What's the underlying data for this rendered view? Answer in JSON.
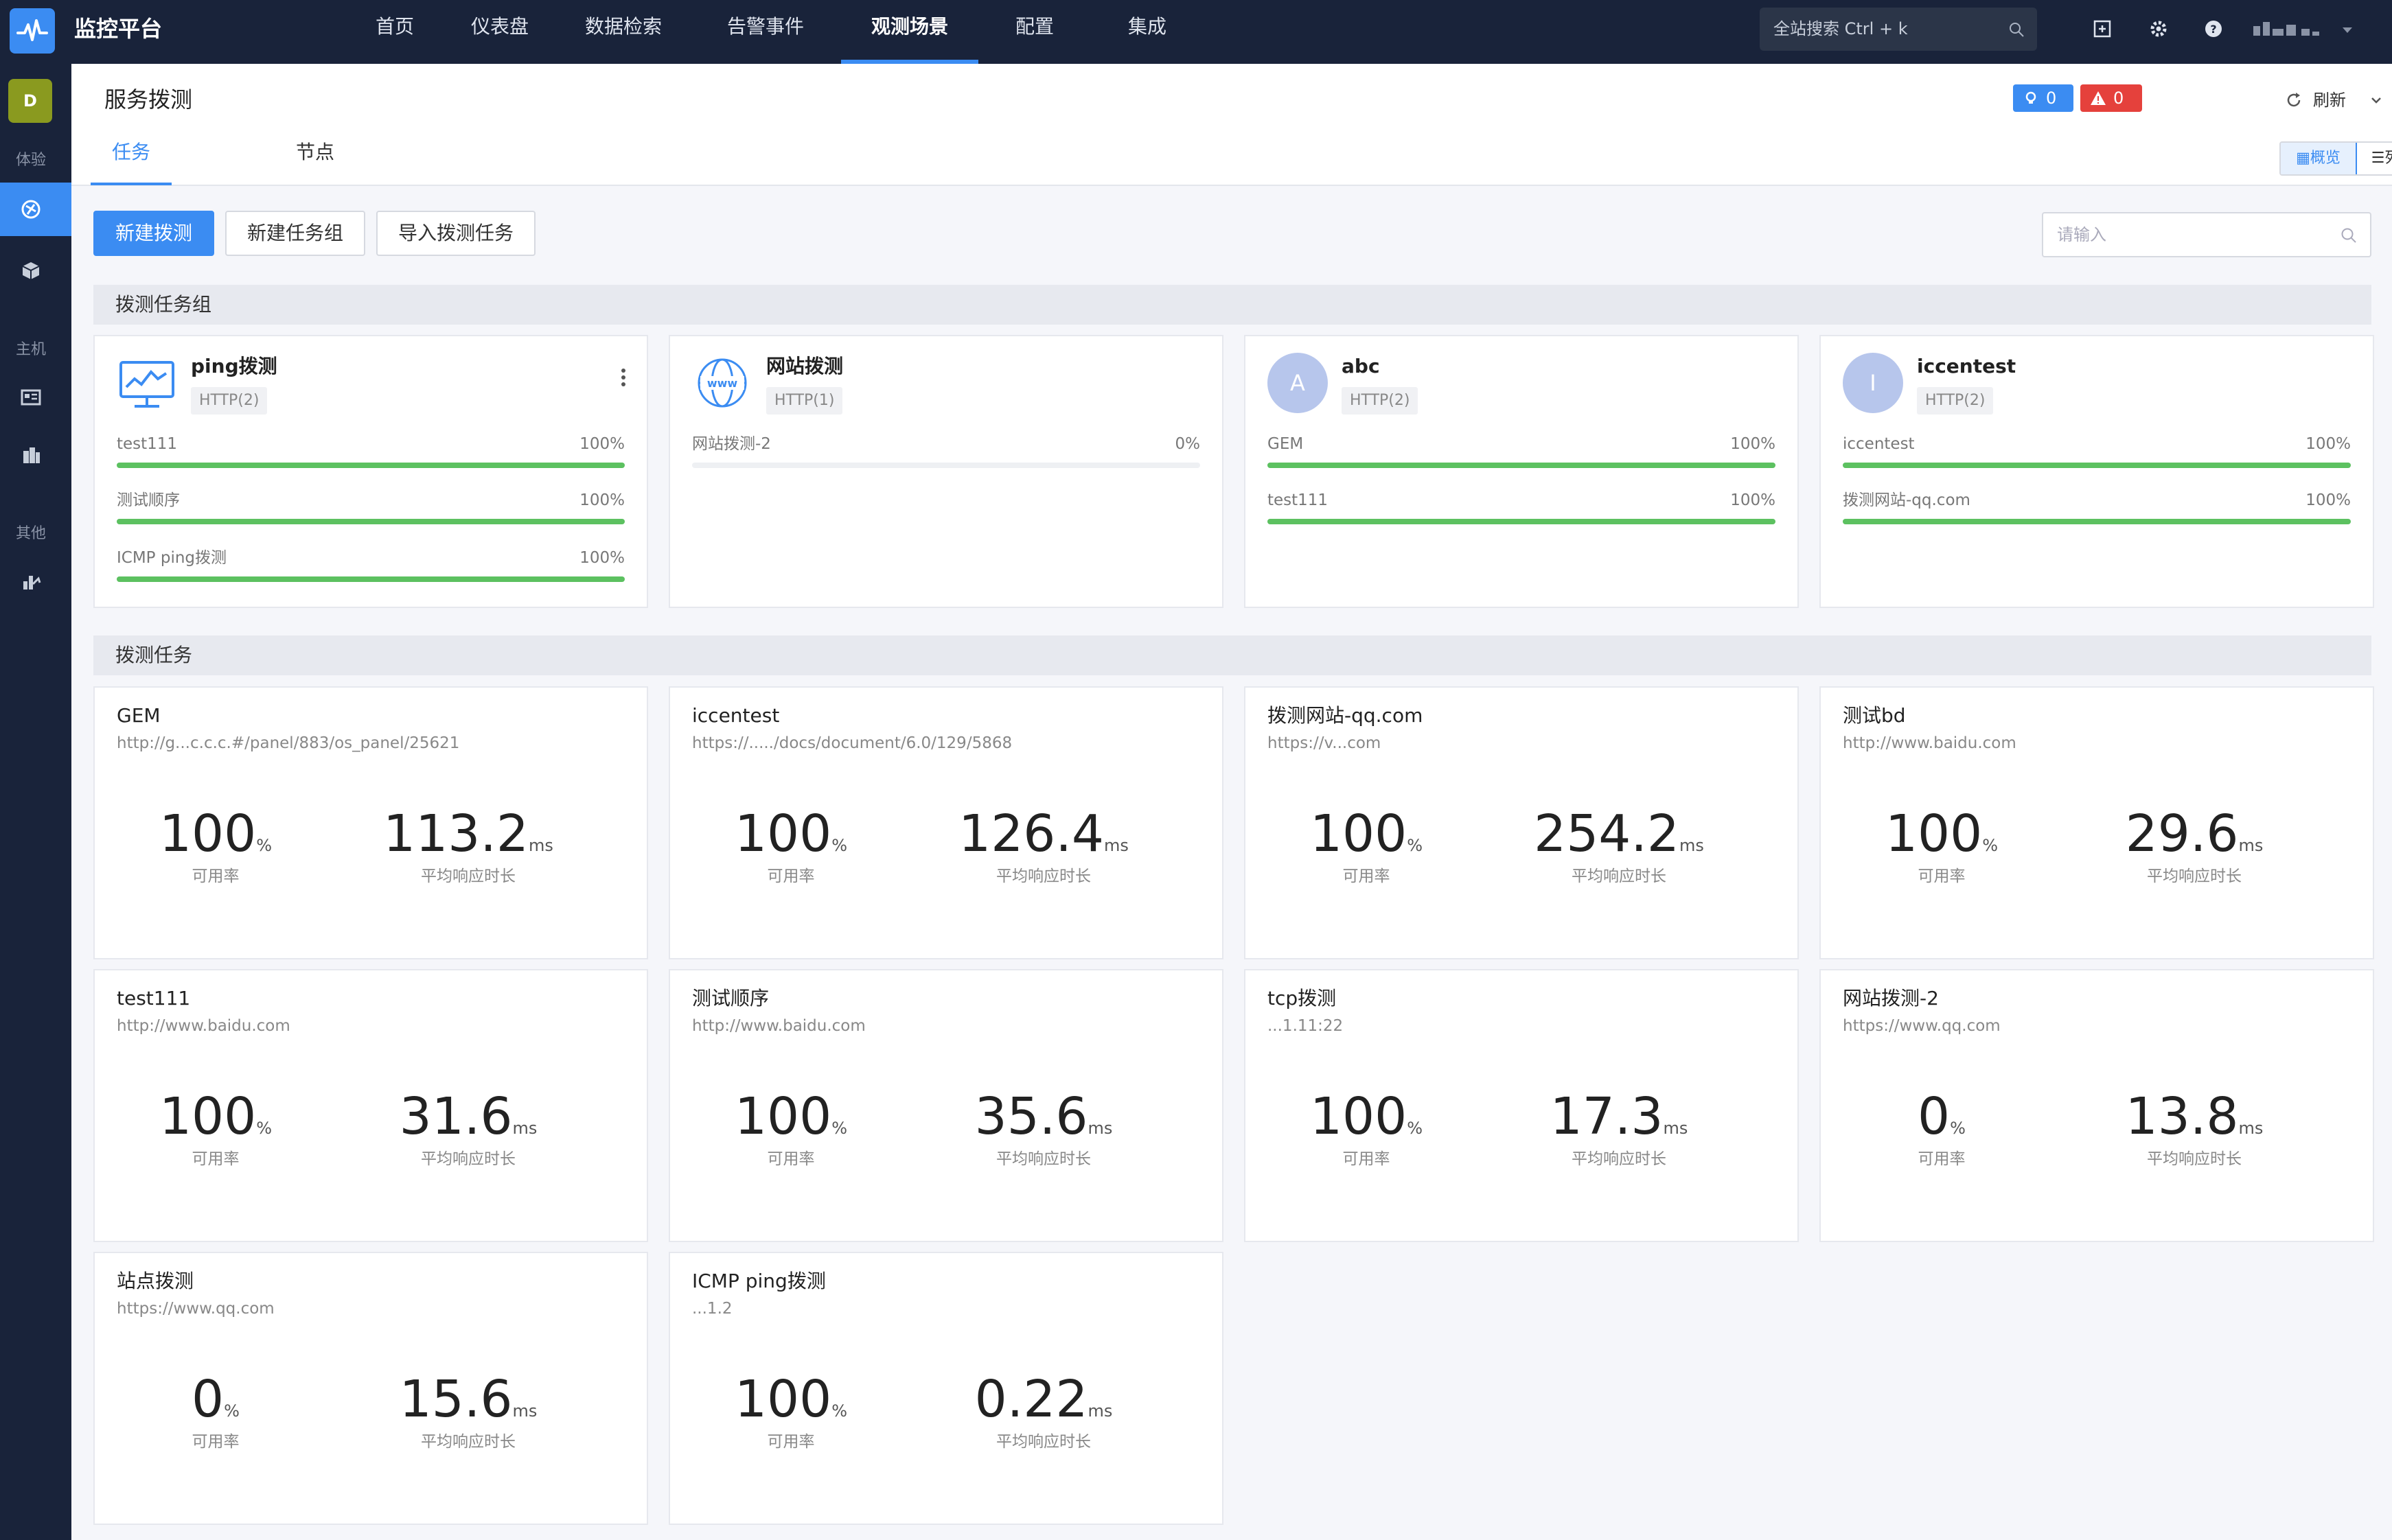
{
  "app": {
    "title": "监控平台"
  },
  "nav": [
    {
      "label": "首页",
      "active": false
    },
    {
      "label": "仪表盘",
      "active": false
    },
    {
      "label": "数据检索",
      "active": false
    },
    {
      "label": "告警事件",
      "active": false
    },
    {
      "label": "观测场景",
      "active": true
    },
    {
      "label": "配置",
      "active": false
    },
    {
      "label": "集成",
      "active": false
    }
  ],
  "global_search": {
    "placeholder": "全站搜索 Ctrl + k"
  },
  "sidebar": {
    "avatar": "D",
    "sections": [
      "体验",
      "主机",
      "其他"
    ],
    "items": [
      {
        "icon": "probe-icon",
        "active": true
      },
      {
        "icon": "cube-icon",
        "active": false
      },
      {
        "icon": "host-list-icon",
        "active": false
      },
      {
        "icon": "building-icon",
        "active": false
      },
      {
        "icon": "chart-mix-icon",
        "active": false
      }
    ]
  },
  "header": {
    "title": "服务拨测",
    "tabs": [
      {
        "label": "任务",
        "active": true
      },
      {
        "label": "节点",
        "active": false
      }
    ],
    "badge_info": "0",
    "badge_alert": "0",
    "refresh": "刷新",
    "view_overview": "概览",
    "view_list": "列表"
  },
  "colors": {
    "accent": "#3b8cf2",
    "topbar": "#19233a",
    "success": "#5cc160",
    "danger": "#e5413c"
  },
  "actions": {
    "new_probe": "新建拨测",
    "new_group": "新建任务组",
    "import": "导入拨测任务",
    "search_placeholder": "请输入"
  },
  "group_section": "拨测任务组",
  "groups": [
    {
      "name": "ping拨测",
      "tag": "HTTP(2)",
      "icon": "monitor-icon",
      "items": [
        {
          "label": "test111",
          "value": "100%",
          "pct": 100
        },
        {
          "label": "测试顺序",
          "value": "100%",
          "pct": 100
        },
        {
          "label": "ICMP ping拨测",
          "value": "100%",
          "pct": 100
        }
      ]
    },
    {
      "name": "网站拨测",
      "tag": "HTTP(1)",
      "icon": "www-globe-icon",
      "items": [
        {
          "label": "网站拨测-2",
          "value": "0%",
          "pct": 0
        }
      ]
    },
    {
      "name": "abc",
      "tag": "HTTP(2)",
      "avatar": "A",
      "items": [
        {
          "label": "GEM",
          "value": "100%",
          "pct": 100
        },
        {
          "label": "test111",
          "value": "100%",
          "pct": 100
        }
      ]
    },
    {
      "name": "iccentest",
      "tag": "HTTP(2)",
      "avatar": "I",
      "items": [
        {
          "label": "iccentest",
          "value": "100%",
          "pct": 100
        },
        {
          "label": "拨测网站-qq.com",
          "value": "100%",
          "pct": 100
        }
      ]
    }
  ],
  "task_section": "拨测任务",
  "tasks": [
    {
      "name": "GEM",
      "url": "http://g...c.c.c.#/panel/883/os_panel/25621",
      "avail": "100",
      "avail_unit": "%",
      "avail_label": "可用率",
      "resp": "113.2",
      "resp_unit": "ms",
      "resp_label": "平均响应时长"
    },
    {
      "name": "iccentest",
      "url": "https://...../docs/document/6.0/129/5868",
      "avail": "100",
      "avail_unit": "%",
      "avail_label": "可用率",
      "resp": "126.4",
      "resp_unit": "ms",
      "resp_label": "平均响应时长"
    },
    {
      "name": "拨测网站-qq.com",
      "url": "https://v...com",
      "avail": "100",
      "avail_unit": "%",
      "avail_label": "可用率",
      "resp": "254.2",
      "resp_unit": "ms",
      "resp_label": "平均响应时长"
    },
    {
      "name": "测试bd",
      "url": "http://www.baidu.com",
      "avail": "100",
      "avail_unit": "%",
      "avail_label": "可用率",
      "resp": "29.6",
      "resp_unit": "ms",
      "resp_label": "平均响应时长"
    },
    {
      "name": "test111",
      "url": "http://www.baidu.com",
      "avail": "100",
      "avail_unit": "%",
      "avail_label": "可用率",
      "resp": "31.6",
      "resp_unit": "ms",
      "resp_label": "平均响应时长"
    },
    {
      "name": "测试顺序",
      "url": "http://www.baidu.com",
      "avail": "100",
      "avail_unit": "%",
      "avail_label": "可用率",
      "resp": "35.6",
      "resp_unit": "ms",
      "resp_label": "平均响应时长"
    },
    {
      "name": "tcp拨测",
      "url": "...1.11:22",
      "avail": "100",
      "avail_unit": "%",
      "avail_label": "可用率",
      "resp": "17.3",
      "resp_unit": "ms",
      "resp_label": "平均响应时长"
    },
    {
      "name": "网站拨测-2",
      "url": "https://www.qq.com",
      "avail": "0",
      "avail_unit": "%",
      "avail_label": "可用率",
      "resp": "13.8",
      "resp_unit": "ms",
      "resp_label": "平均响应时长"
    },
    {
      "name": "站点拨测",
      "url": "https://www.qq.com",
      "avail": "0",
      "avail_unit": "%",
      "avail_label": "可用率",
      "resp": "15.6",
      "resp_unit": "ms",
      "resp_label": "平均响应时长"
    },
    {
      "name": "ICMP ping拨测",
      "url": "...1.2",
      "avail": "100",
      "avail_unit": "%",
      "avail_label": "可用率",
      "resp": "0.22",
      "resp_unit": "ms",
      "resp_label": "平均响应时长"
    }
  ]
}
